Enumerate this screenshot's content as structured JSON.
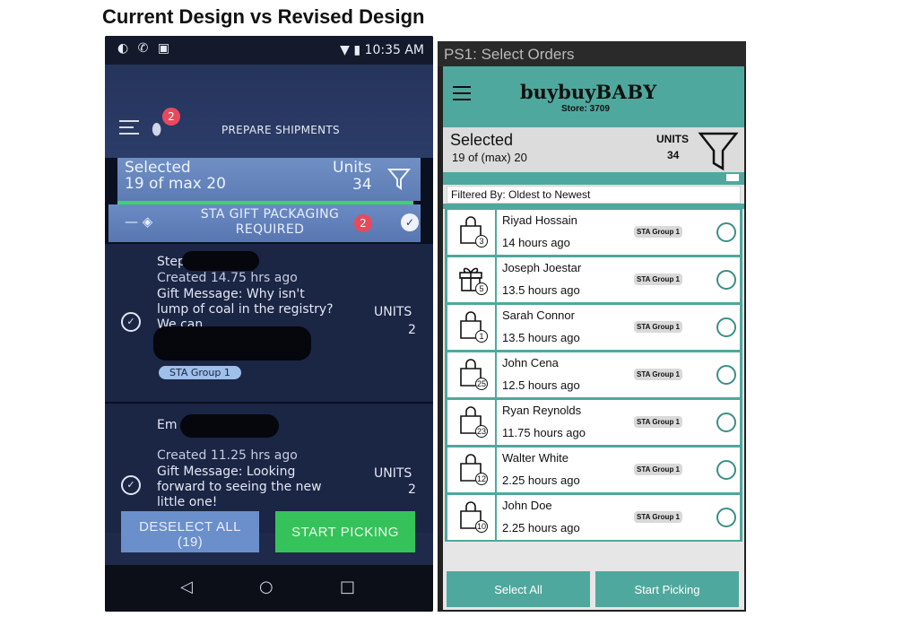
{
  "page": {
    "title": "Current Design vs Revised Design"
  },
  "current": {
    "status": {
      "time": "10:35 AM"
    },
    "app": {
      "title": "PREPARE SHIPMENTS",
      "notification_count": "2"
    },
    "selected": {
      "label": "Selected",
      "value": "19 of max 20",
      "units_label": "Units",
      "units_value": "34"
    },
    "gift_bar": {
      "label": "STA GIFT PACKAGING REQUIRED",
      "count": "2"
    },
    "orders": [
      {
        "name": "Step",
        "created": "Created  14.75 hrs ago",
        "gift": "Gift Message: Why isn't lump of coal in the registry? We can",
        "units_label": "UNITS",
        "units_value": "2",
        "group": "STA Group 1"
      },
      {
        "name": "Em",
        "created": "Created  11.25 hrs ago",
        "gift": "Gift Message: Looking forward to seeing the new little one!",
        "units_label": "UNITS",
        "units_value": "2"
      }
    ],
    "buttons": {
      "deselect": "DESELECT ALL",
      "deselect_count": "(19)",
      "start": "START PICKING"
    },
    "nav": {
      "back": "◁",
      "home": "○",
      "recent": "□"
    }
  },
  "revised": {
    "window_title": "PS1: Select Orders",
    "brand": {
      "part1": "buybuy",
      "part2": "BABY",
      "store": "Store: 3709"
    },
    "selected": {
      "label": "Selected",
      "value": "19 of (max) 20",
      "units_label": "UNITS",
      "units_value": "34"
    },
    "filter_text": "Filtered By: Oldest to Newest",
    "orders": [
      {
        "icon": "bag-icon",
        "count": "3",
        "name": "Riyad Hossain",
        "age": "14 hours ago",
        "group": "STA Group 1"
      },
      {
        "icon": "gift-icon",
        "count": "5",
        "name": "Joseph Joestar",
        "age": "13.5 hours ago",
        "group": "STA Group 1"
      },
      {
        "icon": "bag-icon",
        "count": "1",
        "name": "Sarah Connor",
        "age": "13.5 hours ago",
        "group": "STA Group 1"
      },
      {
        "icon": "bag-icon",
        "count": "25",
        "name": "John Cena",
        "age": "12.5 hours ago",
        "group": "STA Group 1"
      },
      {
        "icon": "bag-icon",
        "count": "23",
        "name": "Ryan Reynolds",
        "age": "11.75 hours ago",
        "group": "STA Group 1"
      },
      {
        "icon": "bag-icon",
        "count": "12",
        "name": "Walter White",
        "age": "2.25 hours ago",
        "group": "STA Group 1"
      },
      {
        "icon": "bag-icon",
        "count": "10",
        "name": "John Doe",
        "age": "2.25 hours ago",
        "group": "STA Group 1"
      }
    ],
    "buttons": {
      "select_all": "Select All",
      "start": "Start Picking"
    }
  },
  "colors": {
    "teal": "#4fa89d",
    "old_blue": "#2b3c68",
    "old_green": "#36c25a",
    "badge_red": "#e74a5c"
  }
}
